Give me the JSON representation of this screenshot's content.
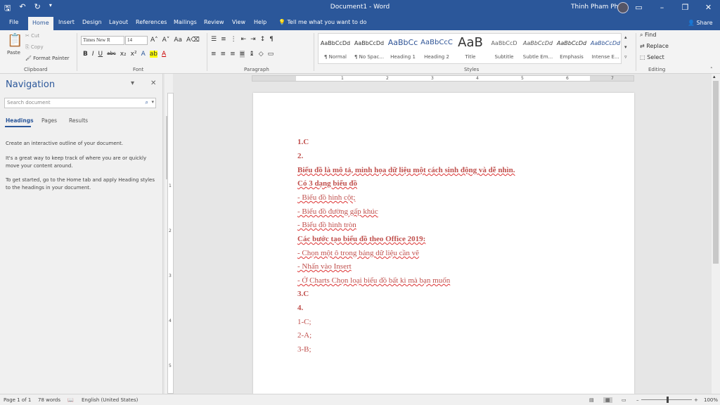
{
  "titlebar": {
    "title": "Document1 - Word",
    "user": "Thinh Pham Phúc"
  },
  "tabs": [
    "File",
    "Home",
    "Insert",
    "Design",
    "Layout",
    "References",
    "Mailings",
    "Review",
    "View",
    "Help"
  ],
  "tell_me": "Tell me what you want to do",
  "share": "Share",
  "clipboard": {
    "paste": "Paste",
    "cut": "Cut",
    "copy": "Copy",
    "format_painter": "Format Painter",
    "label": "Clipboard"
  },
  "font": {
    "name": "Times New R",
    "size": "14",
    "label": "Font"
  },
  "paragraph": {
    "label": "Paragraph"
  },
  "styles": {
    "label": "Styles",
    "items": [
      {
        "preview": "AaBbCcDd",
        "name": "¶ Normal"
      },
      {
        "preview": "AaBbCcDd",
        "name": "¶ No Spac..."
      },
      {
        "preview": "AaBbCc",
        "name": "Heading 1"
      },
      {
        "preview": "AaBbCcC",
        "name": "Heading 2"
      },
      {
        "preview": "AaB",
        "name": "Title"
      },
      {
        "preview": "AaBbCcD",
        "name": "Subtitle"
      },
      {
        "preview": "AaBbCcDd",
        "name": "Subtle Em..."
      },
      {
        "preview": "AaBbCcDd",
        "name": "Emphasis"
      },
      {
        "preview": "AaBbCcDd",
        "name": "Intense E..."
      }
    ]
  },
  "editing": {
    "find": "Find",
    "replace": "Replace",
    "select": "Select",
    "label": "Editing"
  },
  "nav": {
    "title": "Navigation",
    "search_placeholder": "Search document",
    "tabs": [
      "Headings",
      "Pages",
      "Results"
    ],
    "text1": "Create an interactive outline of your document.",
    "text2": "It's a great way to keep track of where you are or quickly move your content around.",
    "text3": "To get started, go to the Home tab and apply Heading styles to the headings in your document."
  },
  "document": {
    "lines": [
      "1.C",
      "2.",
      "Biểu đồ là mô tả, minh họa dữ liệu một cách sinh động và dễ nhìn.",
      "Có 3 dạng biểu đồ",
      "- Biểu đồ hình cột;",
      "- Biểu đồ đường gấp khúc",
      "- Biểu đồ hình tròn",
      "Các bước tạo biểu đồ theo Office 2019:",
      "- Chọn một ô trong bảng dữ liệu cần vẽ",
      "- Nhấn vào Insert",
      "- Ở Charts Chọn loại biểu đồ bất kì mà bạn muốn",
      "3.C",
      "4.",
      "1-C;",
      "2-A;",
      "3-B;"
    ]
  },
  "ruler": [
    "1",
    "2",
    "3",
    "4",
    "5",
    "6",
    "7"
  ],
  "status": {
    "page": "Page 1 of 1",
    "words": "78 words",
    "language": "English (United States)",
    "zoom": "100%"
  }
}
